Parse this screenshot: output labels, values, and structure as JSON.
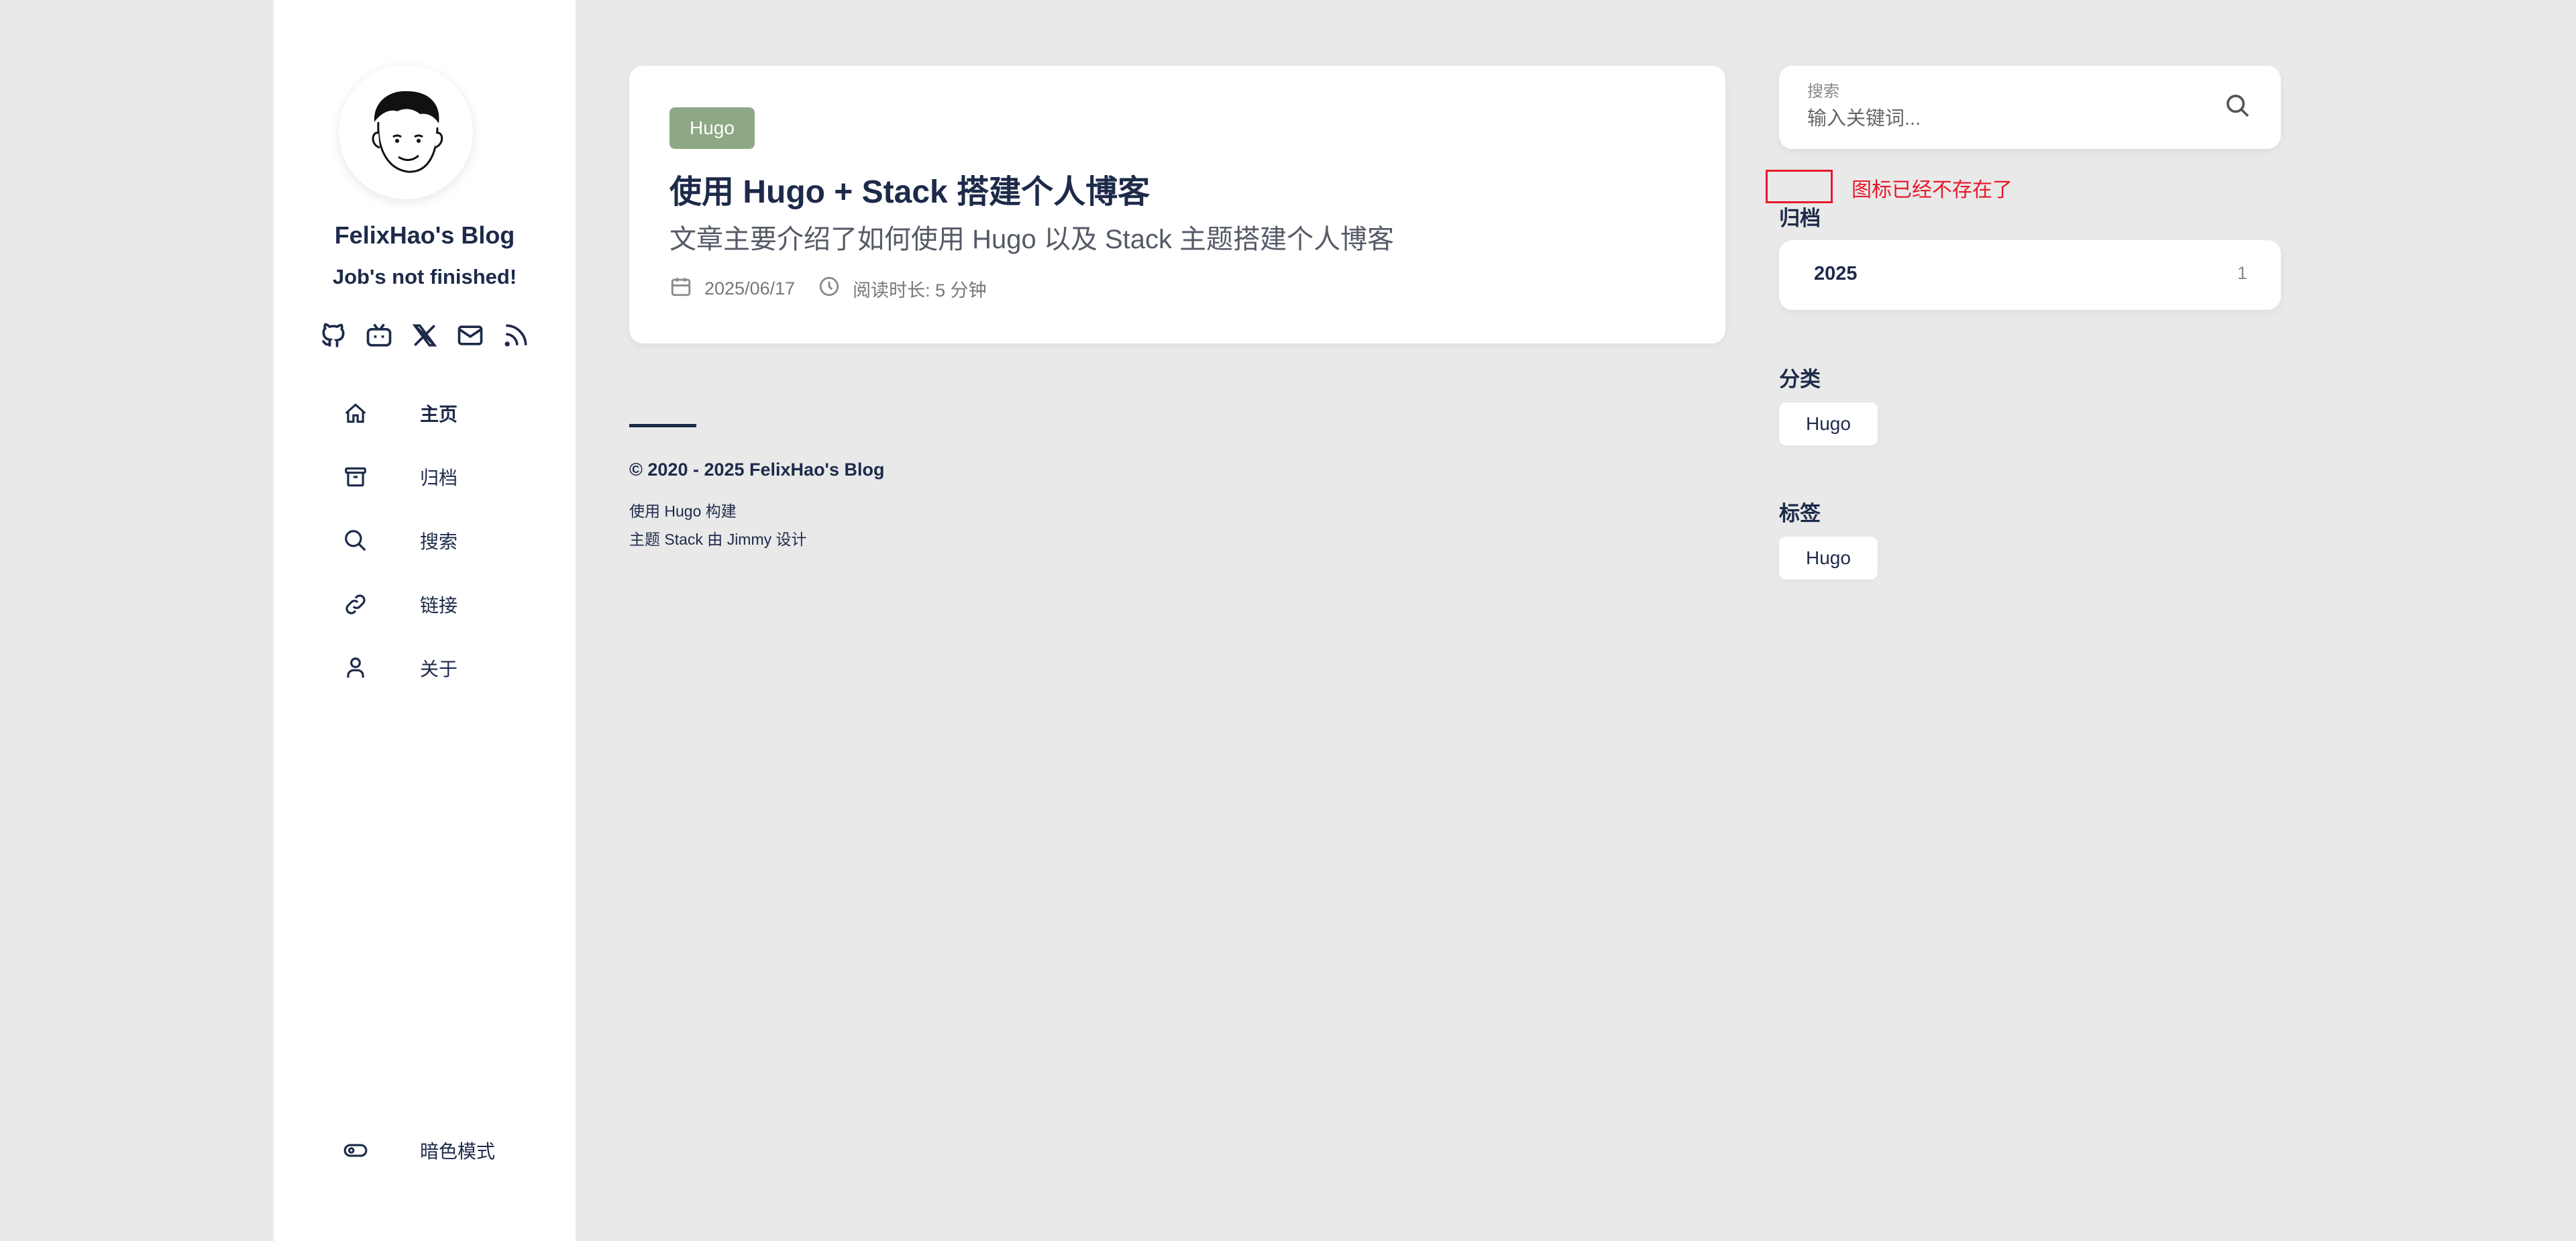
{
  "sidebar": {
    "site_name": "FelixHao's Blog",
    "site_description": "Job's not finished!",
    "social": [
      {
        "icon": "github-icon"
      },
      {
        "icon": "bilibili-icon"
      },
      {
        "icon": "x-icon"
      },
      {
        "icon": "mail-icon"
      },
      {
        "icon": "rss-icon"
      }
    ],
    "menu": [
      {
        "label": "主页",
        "icon": "home-icon",
        "active": true
      },
      {
        "label": "归档",
        "icon": "archive-icon",
        "active": false
      },
      {
        "label": "搜索",
        "icon": "search-icon",
        "active": false
      },
      {
        "label": "链接",
        "icon": "link-icon",
        "active": false
      },
      {
        "label": "关于",
        "icon": "user-icon",
        "active": false
      }
    ],
    "dark_mode_label": "暗色模式"
  },
  "article": {
    "category": "Hugo",
    "title": "使用 Hugo + Stack 搭建个人博客",
    "subtitle": "文章主要介绍了如何使用 Hugo 以及 Stack 主题搭建个人博客",
    "date": "2025/06/17",
    "reading_time": "阅读时长: 5 分钟"
  },
  "footer": {
    "copyright": "© 2020 - 2025 FelixHao's Blog",
    "built_with": "使用 Hugo 构建",
    "theme": "主题 Stack 由 Jimmy 设计"
  },
  "right": {
    "search": {
      "label": "搜索",
      "placeholder": "输入关键词..."
    },
    "annotation": "图标已经不存在了",
    "archives": {
      "title": "归档",
      "year": "2025",
      "count": "1"
    },
    "categories": {
      "title": "分类",
      "items": [
        "Hugo"
      ]
    },
    "tags": {
      "title": "标签",
      "items": [
        "Hugo"
      ]
    }
  },
  "colors": {
    "accent_tag": "#8ea885",
    "text_dark": "#1d2a4a",
    "annotation_red": "#e8192c",
    "background": "#e9e9e9"
  }
}
